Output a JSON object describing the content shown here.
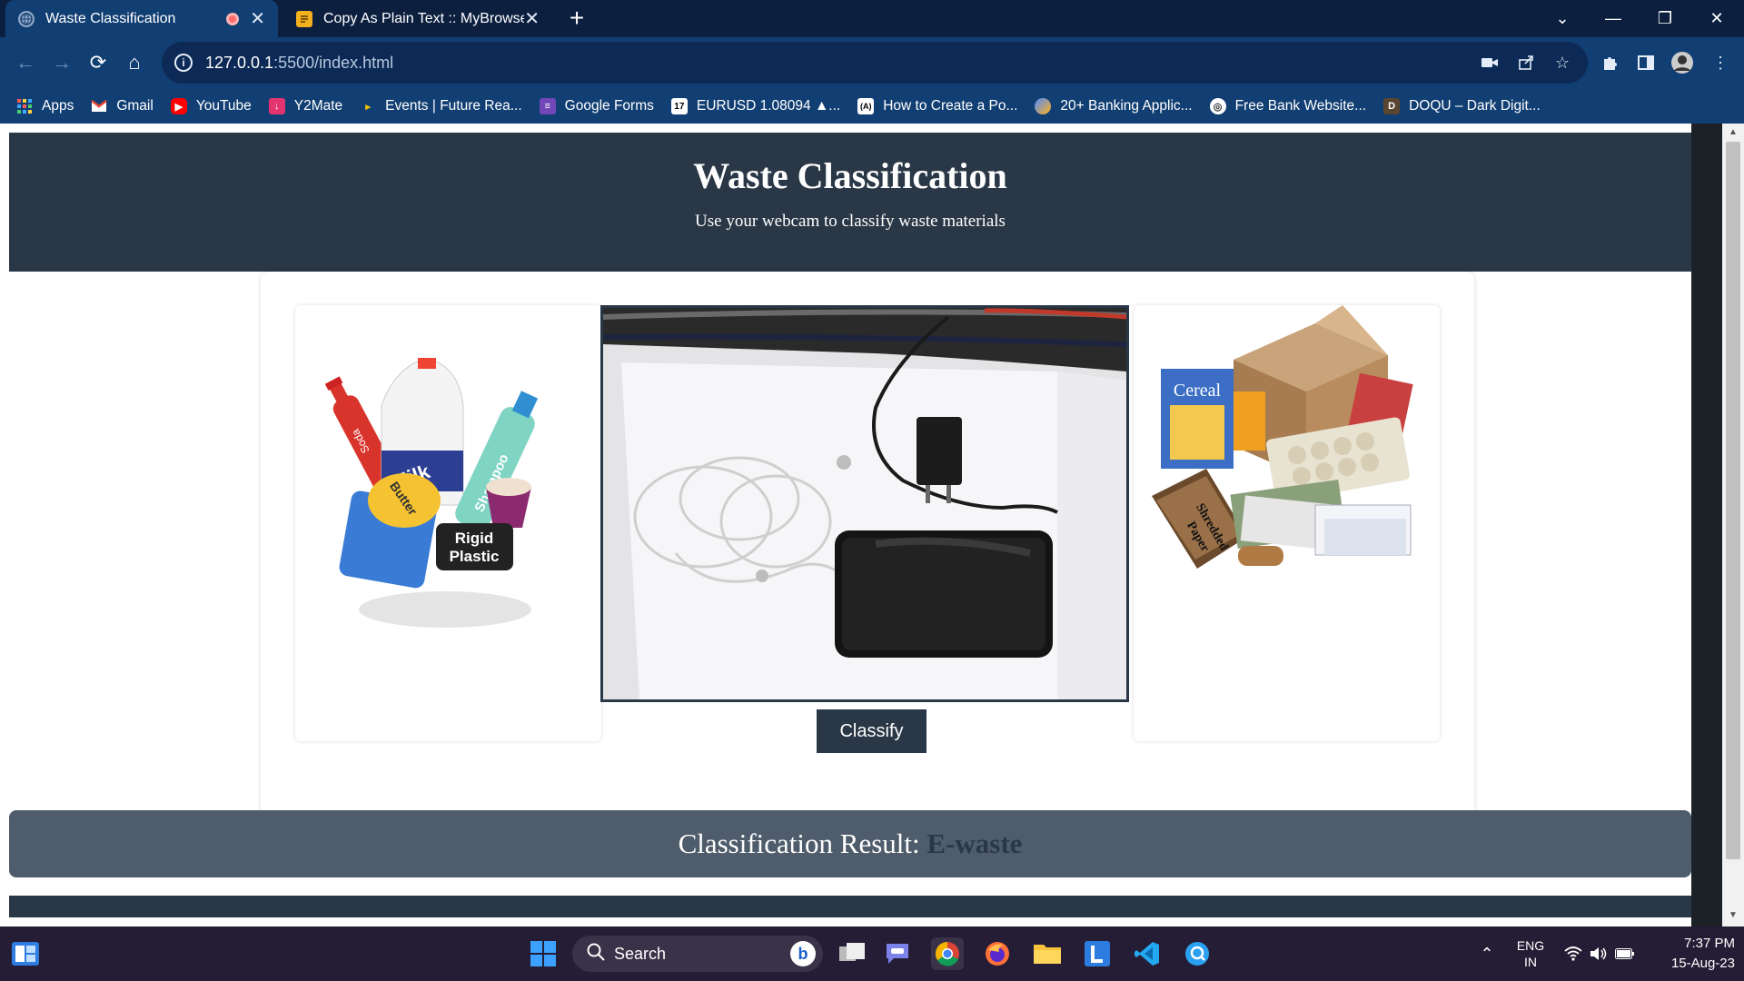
{
  "browser": {
    "tabs": [
      {
        "title": "Waste Classification",
        "active": true
      },
      {
        "title": "Copy As Plain Text :: MyBrowserA",
        "active": false
      }
    ],
    "url_host": "127.0.0.1",
    "url_path": ":5500/index.html",
    "bookmarks": [
      {
        "label": "Apps",
        "icon": "apps-grid-icon"
      },
      {
        "label": "Gmail",
        "icon": "gmail-icon"
      },
      {
        "label": "YouTube",
        "icon": "youtube-icon"
      },
      {
        "label": "Y2Mate",
        "icon": "y2mate-icon"
      },
      {
        "label": "Events | Future Rea...",
        "icon": "events-icon"
      },
      {
        "label": "Google Forms",
        "icon": "google-forms-icon"
      },
      {
        "label": "EURUSD 1.08094 ▲...",
        "icon": "tradingview-icon"
      },
      {
        "label": "How to Create a Po...",
        "icon": "code-icon"
      },
      {
        "label": "20+ Banking Applic...",
        "icon": "banking-icon"
      },
      {
        "label": "Free Bank Website...",
        "icon": "bank-icon"
      },
      {
        "label": "DOQU – Dark Digit...",
        "icon": "doqu-icon"
      }
    ]
  },
  "page": {
    "title": "Waste Classification",
    "subtitle": "Use your webcam to classify waste materials",
    "classify_label": "Classify",
    "result_label": "Classification Result:",
    "result_value": "E-waste",
    "left_image_labels": {
      "soda": "Soda",
      "milk": "Milk",
      "shampoo": "Shampoo",
      "butter": "Butter",
      "rigid": "Rigid",
      "plastic": "Plastic"
    },
    "right_image_labels": {
      "cereal": "Cereal",
      "shredded": "Shredded",
      "paper": "Paper"
    }
  },
  "taskbar": {
    "search_placeholder": "Search",
    "lang_line1": "ENG",
    "lang_line2": "IN",
    "time": "7:37 PM",
    "date": "15-Aug-23"
  },
  "colors": {
    "header_bg": "#2a3746",
    "result_bg": "#4f5c6b",
    "browser_frame": "#123f73"
  }
}
